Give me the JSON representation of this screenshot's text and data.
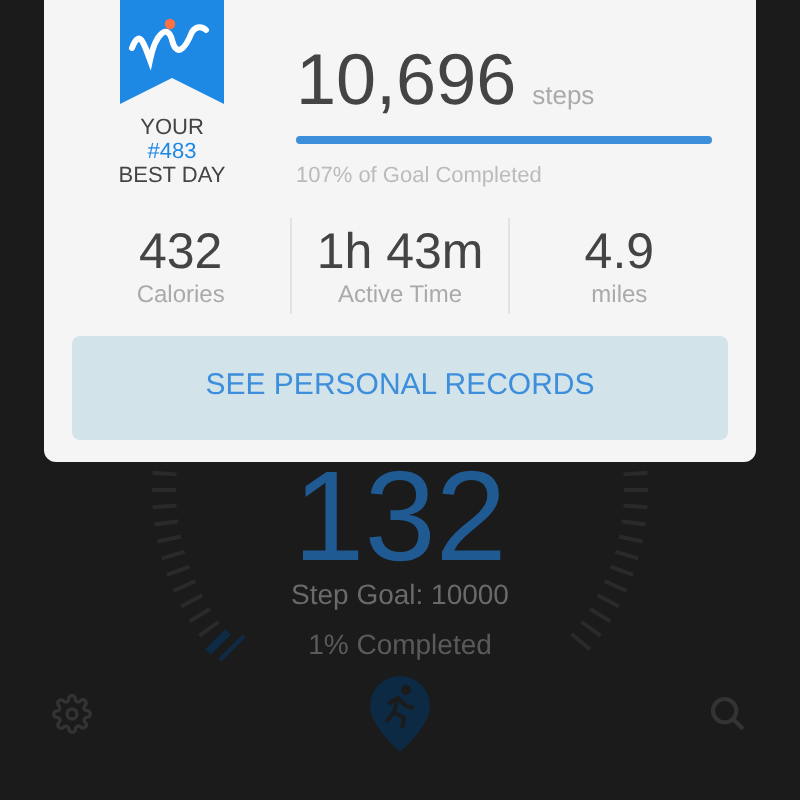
{
  "background": {
    "count": "132",
    "step_goal": "Step Goal: 10000",
    "completed": "1% Completed"
  },
  "dialog": {
    "badge": {
      "line_1": "YOUR",
      "rank": "#483",
      "line_2": "BEST DAY"
    },
    "steps": {
      "value": "10,696",
      "unit": "steps",
      "level": 1,
      "goal_text": "107% of Goal Completed"
    },
    "stats": [
      {
        "value": "432",
        "label": "Calories"
      },
      {
        "value": "1h 43m",
        "label": "Active Time"
      },
      {
        "value": "4.9",
        "label": "miles"
      }
    ],
    "button": "SEE PERSONAL RECORDS"
  }
}
